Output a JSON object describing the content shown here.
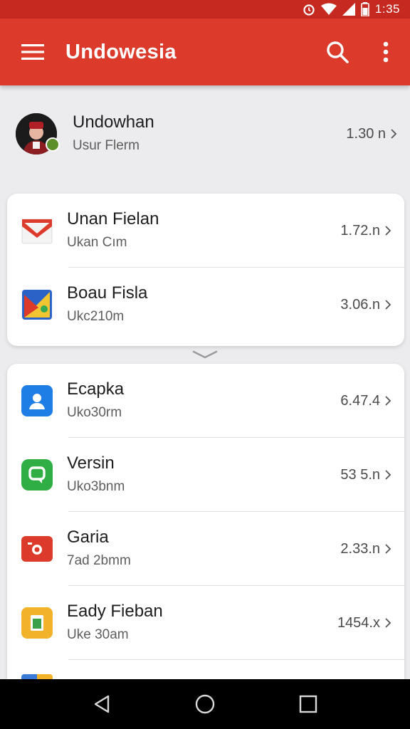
{
  "status_bar": {
    "time": "1:35"
  },
  "app_bar": {
    "title": "Undowesia",
    "color": "#dc3a2b",
    "icons": [
      "menu-icon",
      "search-icon",
      "more-vert-icon"
    ]
  },
  "account": {
    "name": "Undowhan",
    "subtitle": "Usur Flerm",
    "size": "1.30 n"
  },
  "group1": [
    {
      "name": "Unan Fielan",
      "subtitle": "Ukan Cım",
      "size": "1.72.n",
      "icon": "gmail-icon"
    },
    {
      "name": "Boau Fisla",
      "subtitle": "Ukc210m",
      "size": "3.06.n",
      "icon": "maps-icon"
    }
  ],
  "group2": [
    {
      "name": "Ecaрka",
      "subtitle": "Uko30rm",
      "size": "6.47.4",
      "icon": "contacts-icon",
      "color": "#1e7ee6"
    },
    {
      "name": "Versin",
      "subtitle": "Uko3bnm",
      "size": "53 5.n",
      "icon": "hangouts-icon",
      "color": "#2fae44"
    },
    {
      "name": "Garia",
      "subtitle": "7ad 2bmm",
      "size": "2.33.n",
      "icon": "camera-icon",
      "color": "#dc3a2b"
    },
    {
      "name": "Eady Fieban",
      "subtitle": "Uke 30am",
      "size": "1454.x",
      "icon": "keep-icon",
      "color": "#f2b32b"
    }
  ],
  "nav": [
    "back-icon",
    "home-icon",
    "recents-icon"
  ]
}
